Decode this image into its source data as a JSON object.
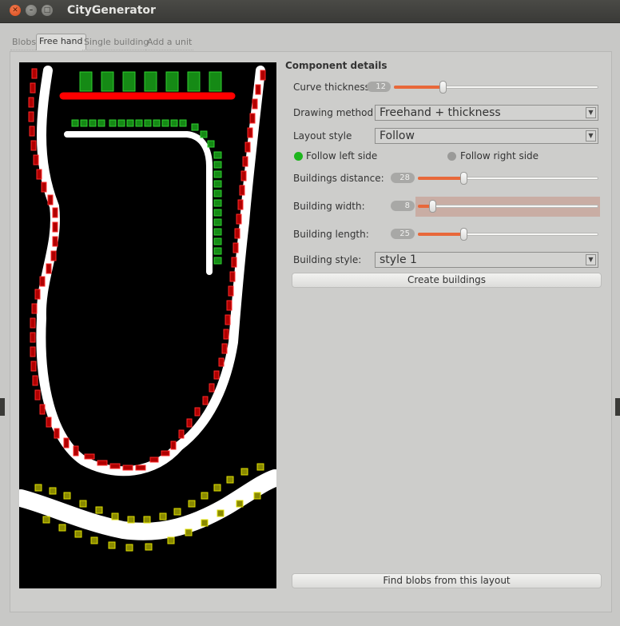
{
  "window": {
    "title": "CityGenerator"
  },
  "tabs": [
    {
      "label": "Blobs"
    },
    {
      "label": "Free hand"
    },
    {
      "label": "Single building"
    },
    {
      "label": "Add a unit"
    }
  ],
  "details": {
    "heading": "Component details",
    "curve_thickness": {
      "label": "Curve thickness:",
      "value": "12",
      "fraction": 0.24
    },
    "drawing_method": {
      "label": "Drawing method",
      "value": "Freehand + thickness"
    },
    "layout_style": {
      "label": "Layout style",
      "value": "Follow"
    },
    "follow_left": {
      "label": "Follow left side",
      "color": "#1db51d"
    },
    "follow_right": {
      "label": "Follow right side",
      "color": "#9a9a98"
    },
    "buildings_distance": {
      "label": "Buildings distance:",
      "value": "28",
      "fraction": 0.25
    },
    "building_width": {
      "label": "Building width:",
      "value": "8",
      "fraction": 0.08
    },
    "building_length": {
      "label": "Building length:",
      "value": "25",
      "fraction": 0.25
    },
    "building_style": {
      "label": "Building style:",
      "value": "style 1"
    },
    "create_button": "Create buildings",
    "find_button": "Find blobs from this layout"
  },
  "colors": {
    "accent": "#e8683a",
    "curve": "#ffffff",
    "red_buildings": "#cc0000",
    "green_buildings": "#1a9a1a",
    "yellow_buildings": "#c8c800"
  }
}
